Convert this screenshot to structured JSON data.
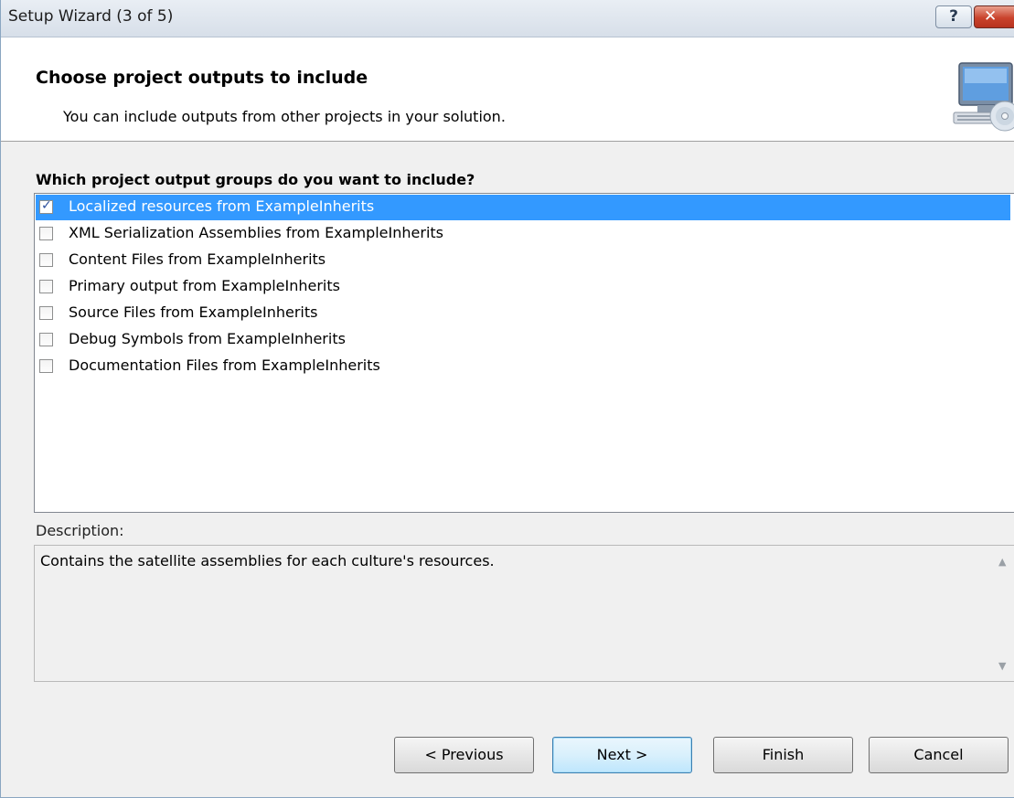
{
  "window": {
    "title": "Setup Wizard (3 of 5)",
    "help_glyph": "?",
    "close_glyph": "✕"
  },
  "header": {
    "heading": "Choose project outputs to include",
    "subtext": "You can include outputs from other projects in your solution.",
    "icon": "computer-cd-icon"
  },
  "question": "Which project output groups do you want to include?",
  "output_groups": [
    {
      "label": "Localized resources from ExampleInherits",
      "checked": true,
      "selected": true
    },
    {
      "label": "XML Serialization Assemblies from ExampleInherits",
      "checked": false,
      "selected": false
    },
    {
      "label": "Content Files from ExampleInherits",
      "checked": false,
      "selected": false
    },
    {
      "label": "Primary output from ExampleInherits",
      "checked": false,
      "selected": false
    },
    {
      "label": "Source Files from ExampleInherits",
      "checked": false,
      "selected": false
    },
    {
      "label": "Debug Symbols from ExampleInherits",
      "checked": false,
      "selected": false
    },
    {
      "label": "Documentation Files from ExampleInherits",
      "checked": false,
      "selected": false
    }
  ],
  "description": {
    "label": "Description:",
    "text": "Contains the satellite assemblies for each culture's resources."
  },
  "buttons": {
    "previous": "< Previous",
    "next": "Next >",
    "finish": "Finish",
    "cancel": "Cancel"
  },
  "colors": {
    "selection": "#3399ff",
    "close_button": "#c9432c"
  }
}
